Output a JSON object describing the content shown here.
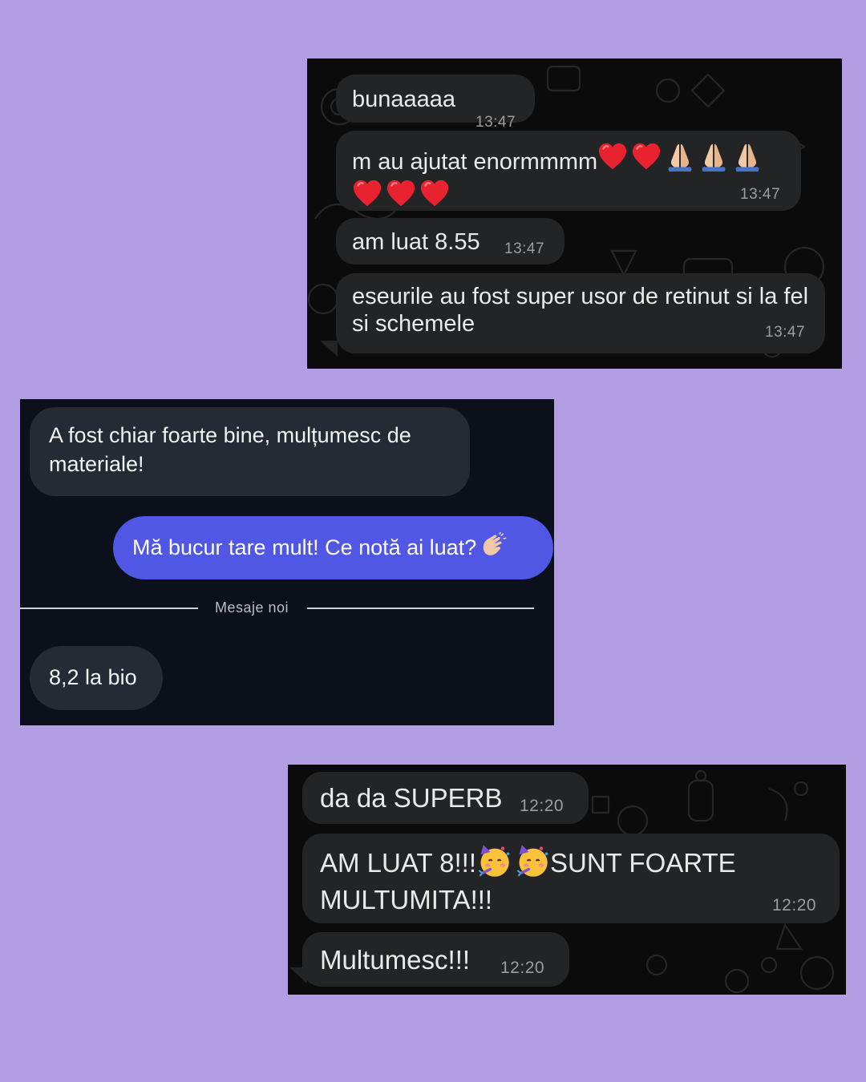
{
  "colors": {
    "page_background": "#b39de3",
    "whatsapp_bubble": "#232425",
    "instagram_incoming": "#262a34",
    "instagram_outgoing": "#5057e5",
    "heart": "#e8222f",
    "hands_skin": "#f1c9a5"
  },
  "chat1": {
    "messages": [
      {
        "text": "bunaaaaa",
        "time": "13:47"
      },
      {
        "text": "m au ajutat enormmmm",
        "emojis": [
          "heart",
          "heart",
          "folded-hands",
          "folded-hands",
          "folded-hands",
          "heart",
          "heart",
          "heart"
        ],
        "time": "13:47"
      },
      {
        "text": "am luat 8.55",
        "time": "13:47"
      },
      {
        "text": "eseurile au fost super usor de retinut si la fel si schemele",
        "time": "13:47"
      }
    ]
  },
  "chat2": {
    "messages": [
      {
        "text": "A fost chiar foarte bine, mulțumesc de materiale!",
        "direction": "incoming"
      },
      {
        "text": "Mă bucur tare mult! Ce notă ai luat?",
        "emoji": "clapping-hands",
        "direction": "outgoing"
      }
    ],
    "divider_label": "Mesaje noi",
    "new_messages": [
      {
        "text": "8,2 la bio",
        "direction": "incoming"
      }
    ]
  },
  "chat3": {
    "messages": [
      {
        "text": "da da SUPERB",
        "time": "12:20"
      },
      {
        "text_part1": "AM LUAT 8!!!",
        "emojis": [
          "partying-face",
          "partying-face"
        ],
        "text_part2": "SUNT FOARTE",
        "text_line2": "MULTUMITA!!!",
        "time": "12:20"
      },
      {
        "text": "Multumesc!!!",
        "time": "12:20"
      }
    ]
  }
}
